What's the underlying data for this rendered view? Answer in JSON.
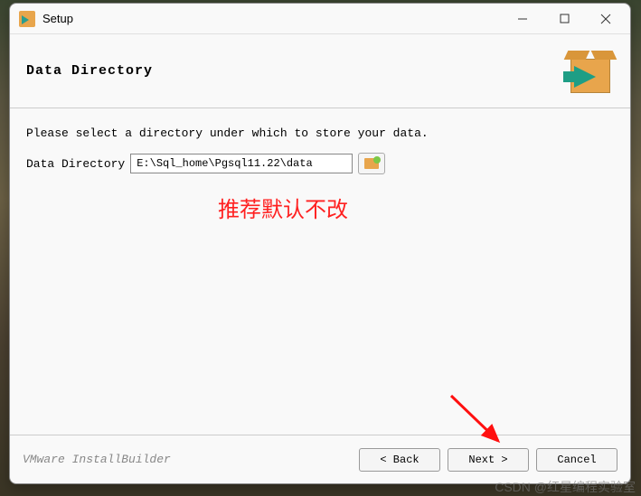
{
  "titlebar": {
    "title": "Setup"
  },
  "header": {
    "title": "Data Directory"
  },
  "content": {
    "prompt": "Please select a directory under which to store your data.",
    "field_label": "Data Directory",
    "field_value": "E:\\Sql_home\\Pgsql11.22\\data",
    "annotation": "推荐默认不改"
  },
  "footer": {
    "brand": "VMware InstallBuilder",
    "back": "< Back",
    "next": "Next >",
    "cancel": "Cancel"
  },
  "watermark": "CSDN @红星编程实验室"
}
